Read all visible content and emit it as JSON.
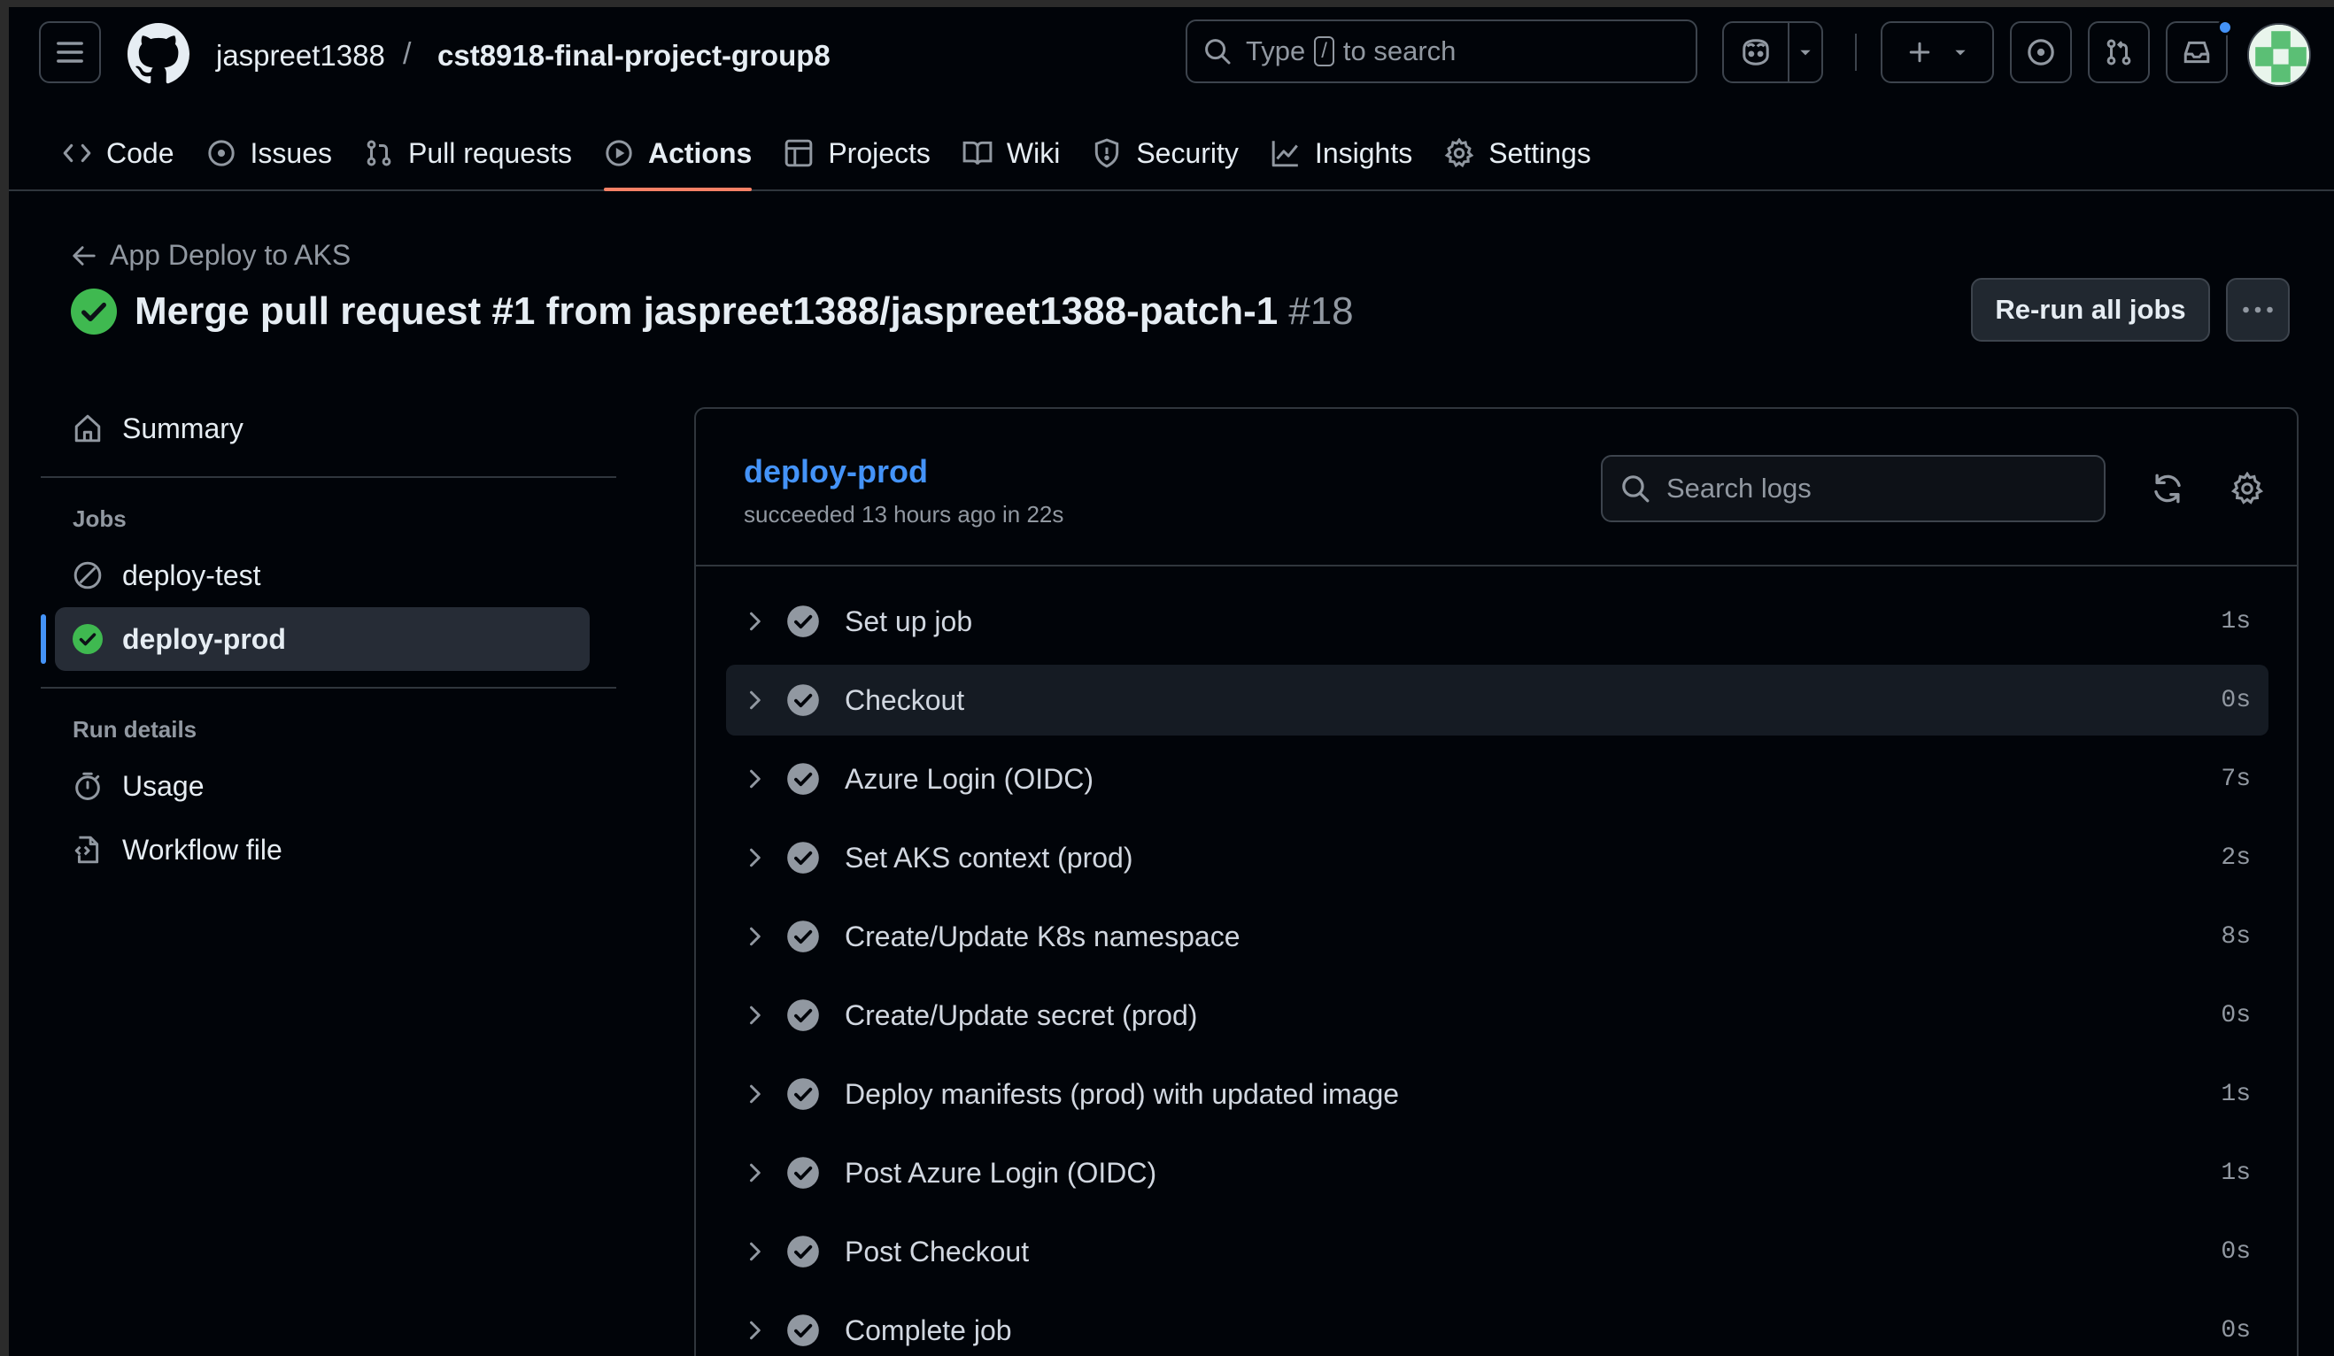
{
  "header": {
    "owner": "jaspreet1388",
    "separator": "/",
    "repo": "cst8918-final-project-group8",
    "search": {
      "prefix": "Type",
      "key": "/",
      "suffix": "to search"
    }
  },
  "tabs": [
    {
      "label": "Code",
      "icon": "code-icon"
    },
    {
      "label": "Issues",
      "icon": "issue-icon"
    },
    {
      "label": "Pull requests",
      "icon": "pull-request-icon"
    },
    {
      "label": "Actions",
      "icon": "play-icon",
      "active": true
    },
    {
      "label": "Projects",
      "icon": "table-icon"
    },
    {
      "label": "Wiki",
      "icon": "book-icon"
    },
    {
      "label": "Security",
      "icon": "shield-icon"
    },
    {
      "label": "Insights",
      "icon": "graph-icon"
    },
    {
      "label": "Settings",
      "icon": "gear-icon"
    }
  ],
  "run": {
    "back_label": "App Deploy to AKS",
    "title": "Merge pull request #1 from jaspreet1388/jaspreet1388-patch-1",
    "number": "#18",
    "rerun_label": "Re-run all jobs"
  },
  "sidebar": {
    "summary_label": "Summary",
    "jobs_heading": "Jobs",
    "jobs": [
      {
        "label": "deploy-test",
        "status": "skipped"
      },
      {
        "label": "deploy-prod",
        "status": "success",
        "selected": true
      }
    ],
    "run_details_heading": "Run details",
    "details": [
      {
        "label": "Usage",
        "icon": "stopwatch-icon"
      },
      {
        "label": "Workflow file",
        "icon": "file-code-icon"
      }
    ]
  },
  "job": {
    "name": "deploy-prod",
    "status_text": "succeeded 13 hours ago in 22s",
    "search_placeholder": "Search logs",
    "steps": [
      {
        "label": "Set up job",
        "duration": "1s"
      },
      {
        "label": "Checkout",
        "duration": "0s"
      },
      {
        "label": "Azure Login (OIDC)",
        "duration": "7s"
      },
      {
        "label": "Set AKS context (prod)",
        "duration": "2s"
      },
      {
        "label": "Create/Update K8s namespace",
        "duration": "8s"
      },
      {
        "label": "Create/Update secret (prod)",
        "duration": "0s"
      },
      {
        "label": "Deploy manifests (prod) with updated image",
        "duration": "1s"
      },
      {
        "label": "Post Azure Login (OIDC)",
        "duration": "1s"
      },
      {
        "label": "Post Checkout",
        "duration": "0s"
      },
      {
        "label": "Complete job",
        "duration": "0s"
      }
    ]
  },
  "colors": {
    "accent_blue": "#4493f8",
    "success_green": "#3fb950",
    "active_underline": "#f78166",
    "background": "#010409"
  }
}
